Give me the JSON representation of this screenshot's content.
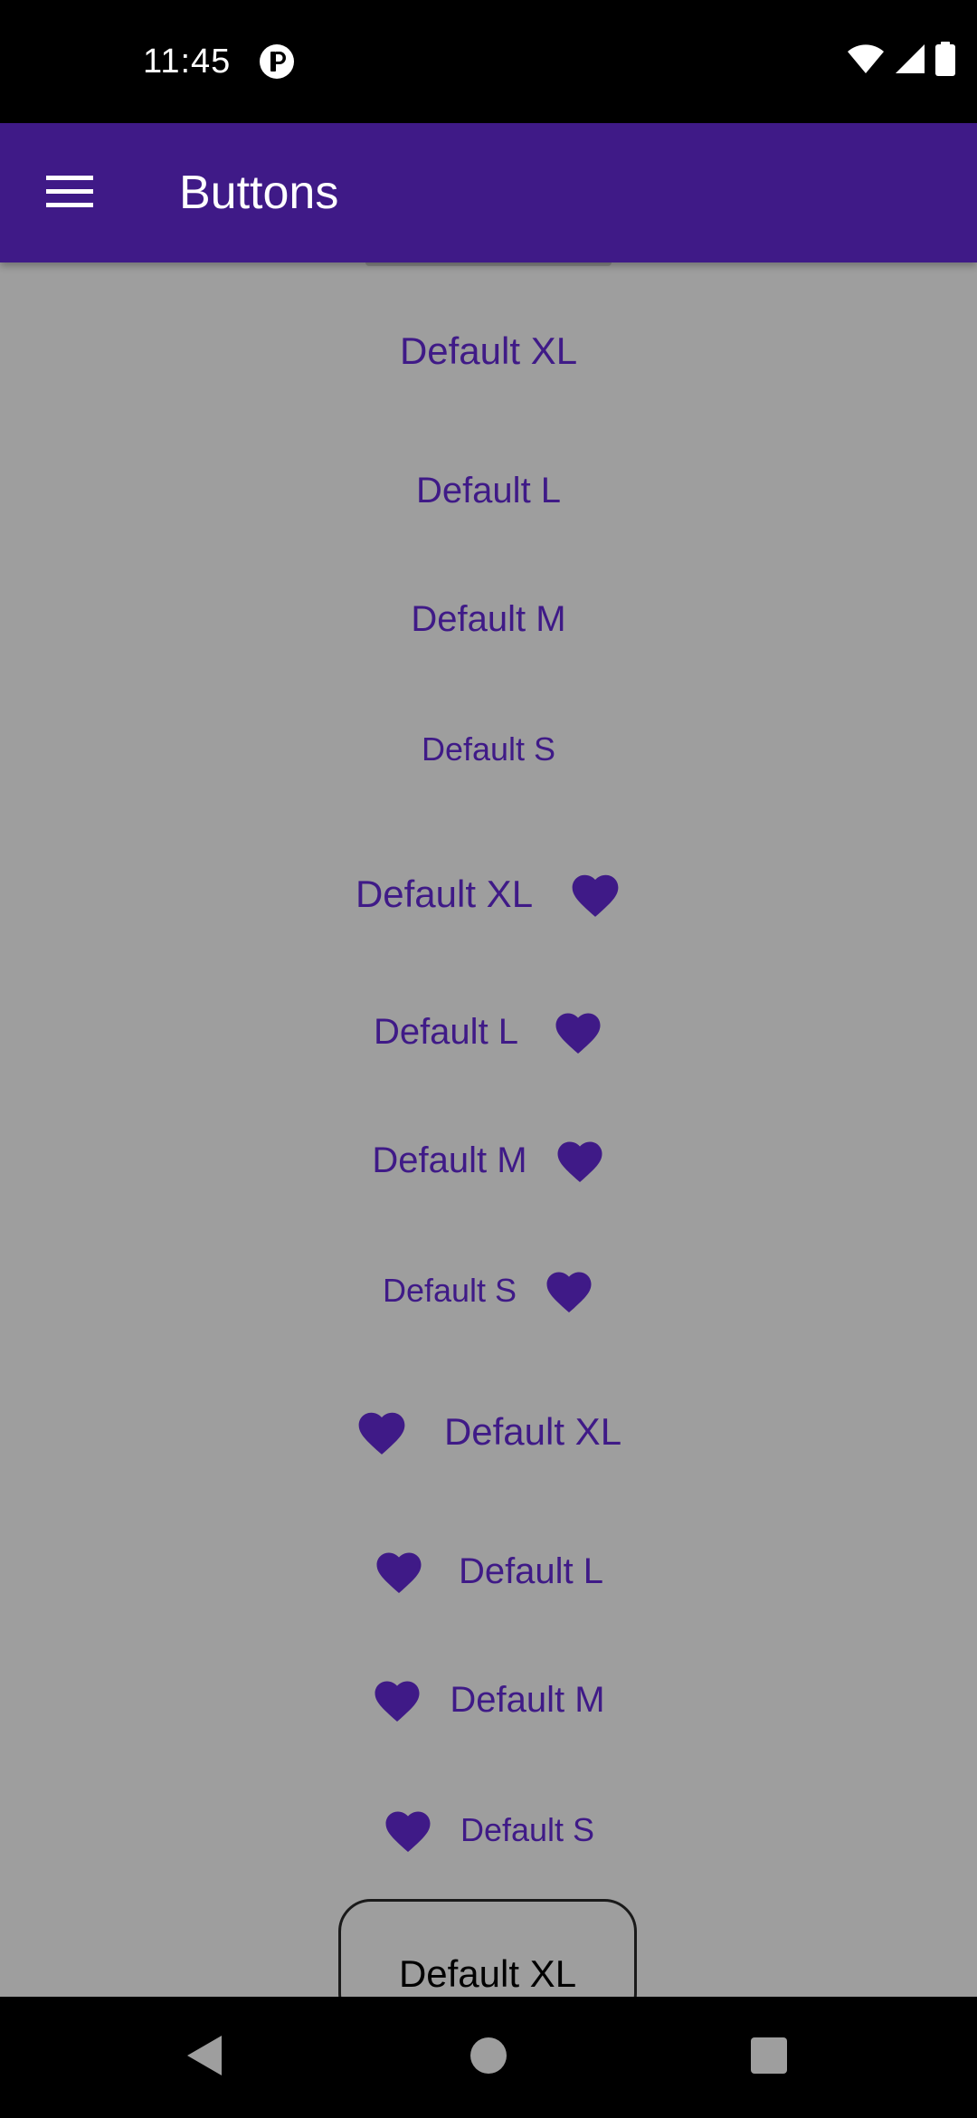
{
  "status_bar": {
    "time": "11:45",
    "app_icon": "notification-app-icon",
    "wifi_icon": "wifi-icon",
    "signal_icon": "cell-signal-icon",
    "battery_icon": "battery-icon"
  },
  "app_bar": {
    "title": "Buttons",
    "menu_icon": "hamburger-menu-icon",
    "background": "#3f1a87"
  },
  "buttons": {
    "text_only": [
      {
        "label": "Default XL",
        "size": "XL"
      },
      {
        "label": "Default L",
        "size": "L"
      },
      {
        "label": "Default M",
        "size": "M"
      },
      {
        "label": "Default S",
        "size": "S"
      }
    ],
    "trailing_icon": [
      {
        "label": "Default XL",
        "size": "XL",
        "icon": "heart-icon"
      },
      {
        "label": "Default L",
        "size": "L",
        "icon": "heart-icon"
      },
      {
        "label": "Default M",
        "size": "M",
        "icon": "heart-icon"
      },
      {
        "label": "Default S",
        "size": "S",
        "icon": "heart-icon"
      }
    ],
    "leading_icon": [
      {
        "label": "Default XL",
        "size": "XL",
        "icon": "heart-icon"
      },
      {
        "label": "Default L",
        "size": "L",
        "icon": "heart-icon"
      },
      {
        "label": "Default M",
        "size": "M",
        "icon": "heart-icon"
      },
      {
        "label": "Default S",
        "size": "S",
        "icon": "heart-icon"
      }
    ],
    "outlined": [
      {
        "label": "Default XL",
        "size": "XL"
      }
    ]
  },
  "colors": {
    "accent": "#3f1a87",
    "content_background": "#9e9e9e",
    "system_bars": "#000000"
  },
  "nav_bar": {
    "back_icon": "back-triangle-icon",
    "home_icon": "home-circle-icon",
    "recents_icon": "recents-square-icon"
  }
}
